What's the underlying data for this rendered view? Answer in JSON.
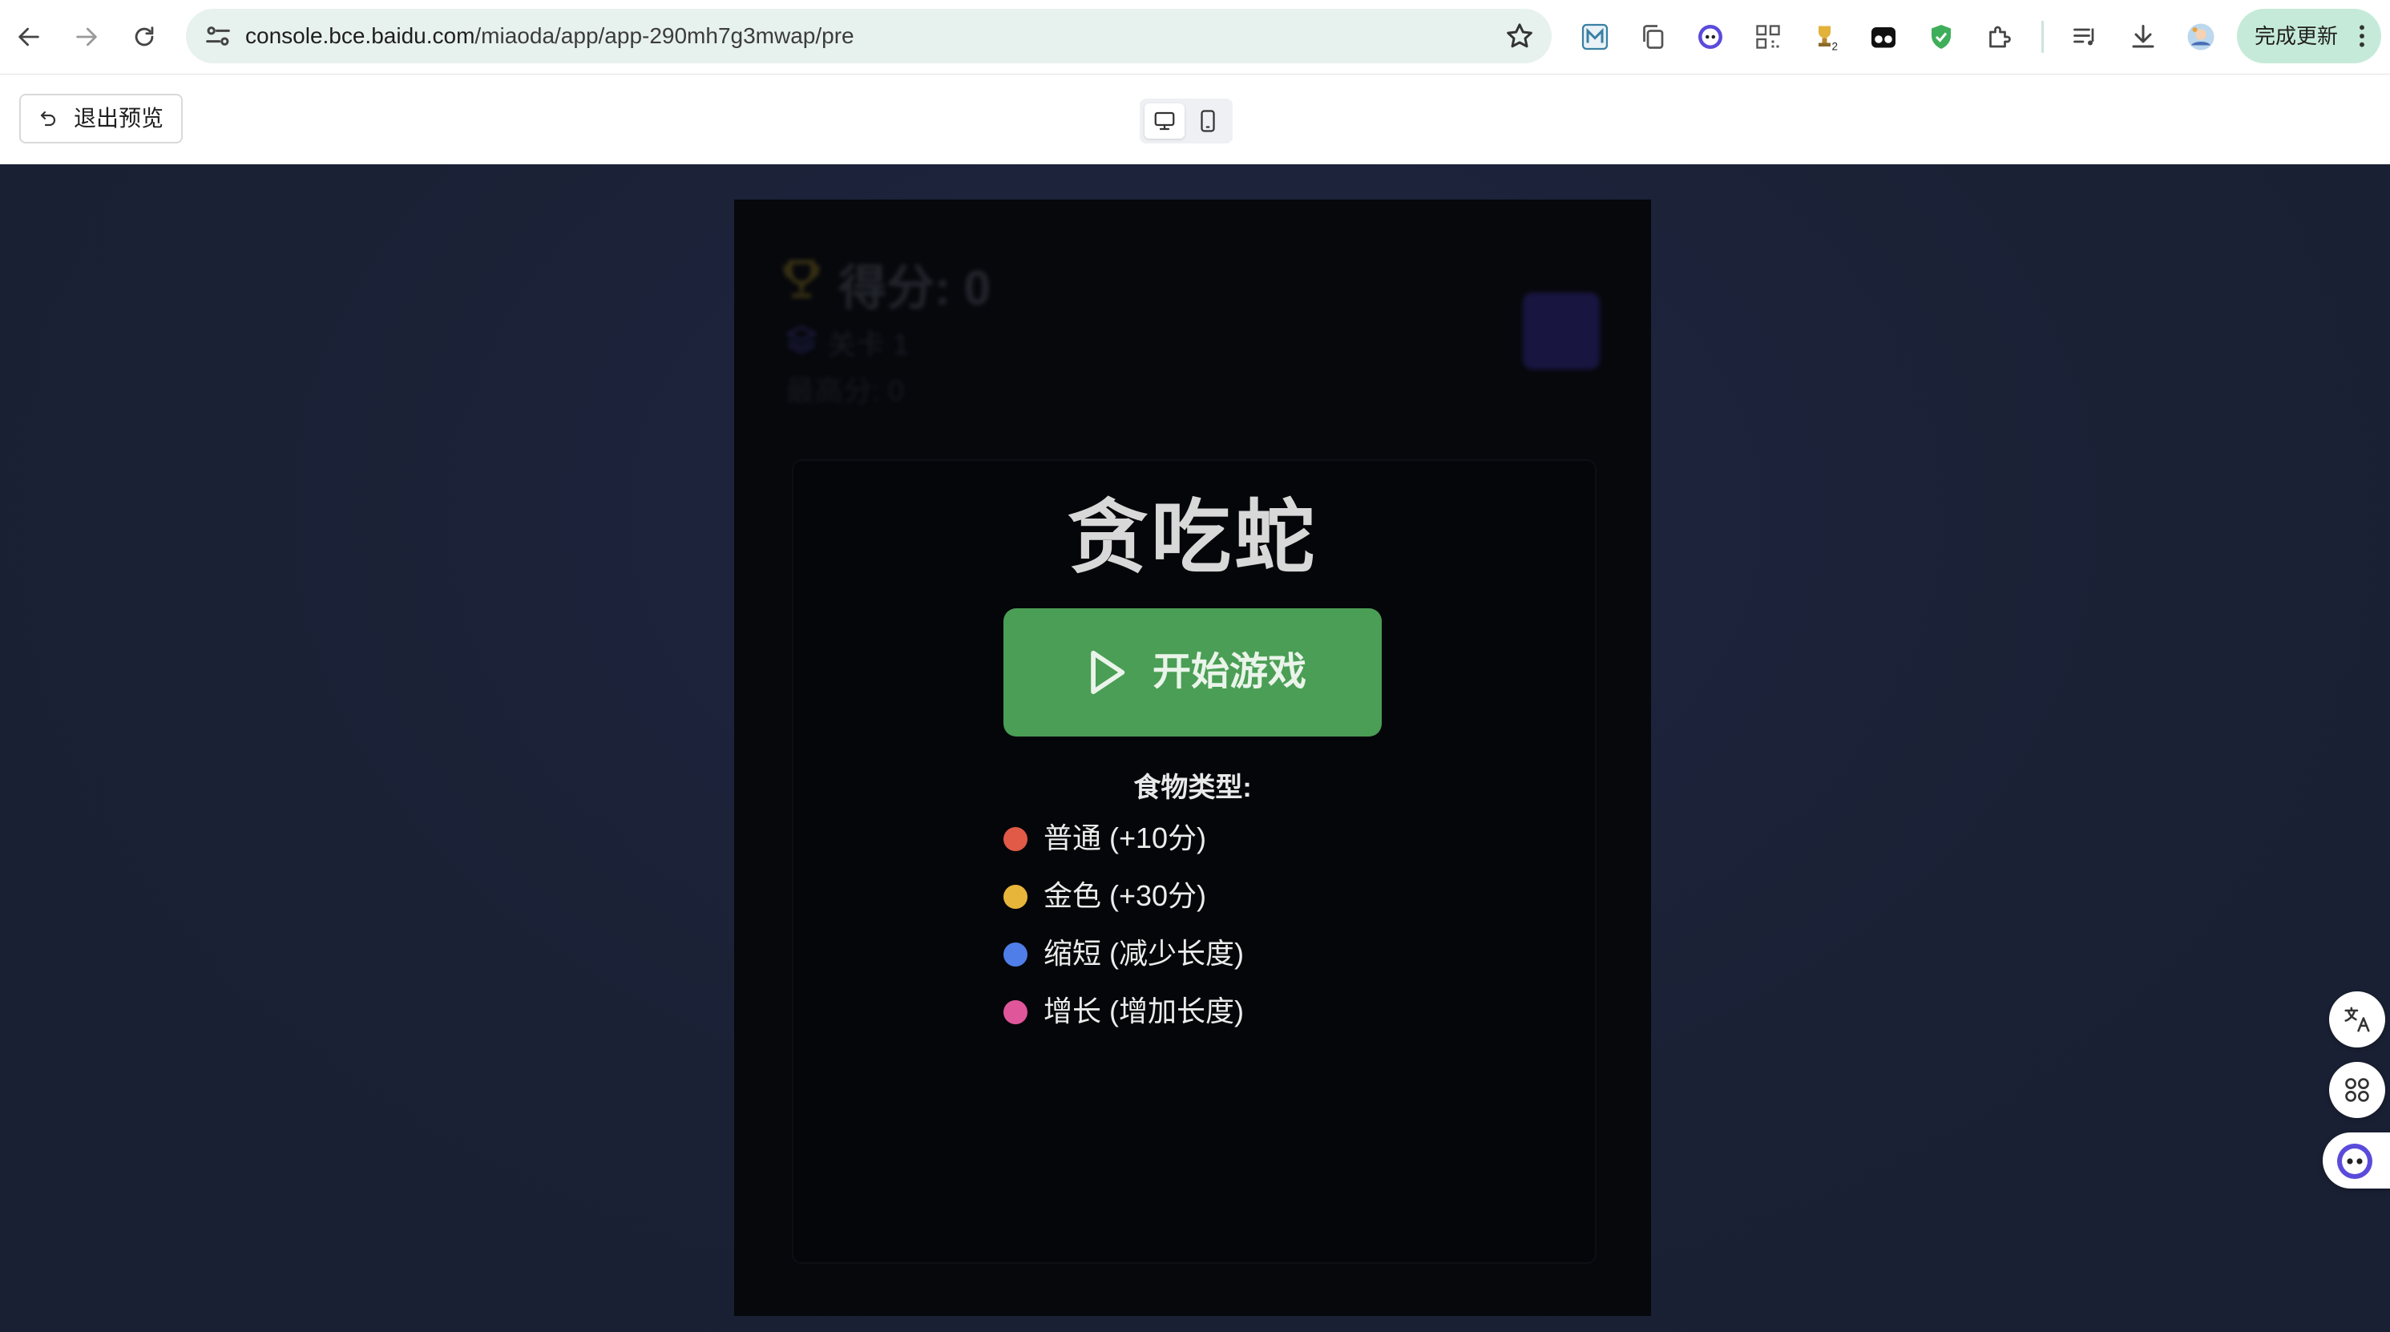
{
  "browser": {
    "url_host": "console.bce.baidu.com",
    "url_path": "/miaoda/app/app-290mh7g3mwap/pre",
    "update_button_label": "完成更新",
    "extension_badge": "2",
    "icons": [
      "back-icon",
      "forward-icon",
      "reload-icon",
      "site-info-icon",
      "bookmark-star-icon",
      "extension-m-icon",
      "extension-copy-icon",
      "extension-face-icon",
      "extension-qr-icon",
      "extension-trophy-icon",
      "extension-glasses-icon",
      "extension-shield-icon",
      "extensions-puzzle-icon",
      "media-control-icon",
      "download-icon",
      "profile-avatar-icon",
      "menu-kebab-icon"
    ]
  },
  "preview_toolbar": {
    "exit_label": "退出预览",
    "device_modes": [
      "desktop",
      "mobile"
    ],
    "active_device": "desktop"
  },
  "game": {
    "score_text": "得分: 0",
    "level_text": "关卡 1",
    "best_text": "最高分: 0",
    "title": "贪吃蛇",
    "start_label": "开始游戏",
    "food_heading": "食物类型:",
    "foods": [
      {
        "label": "普通 (+10分)",
        "color": "#e05a47"
      },
      {
        "label": "金色 (+30分)",
        "color": "#e8b53b"
      },
      {
        "label": "缩短 (减少长度)",
        "color": "#4f7ee8"
      },
      {
        "label": "增长 (增加长度)",
        "color": "#e0569a"
      }
    ]
  },
  "side_buttons": [
    "translate-icon",
    "apps-grid-icon",
    "assistant-bot-icon"
  ],
  "colors": {
    "accent_green": "#4a9e55",
    "page_bg": "#1c2336",
    "game_bg": "#07080c"
  }
}
